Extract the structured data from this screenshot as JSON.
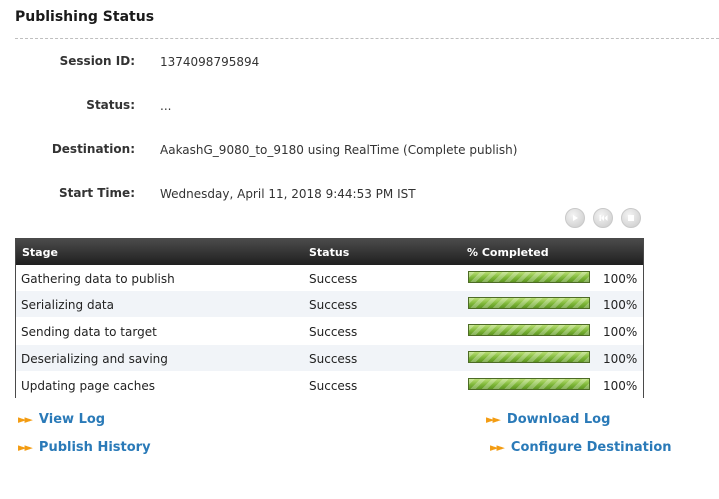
{
  "header": {
    "title": "Publishing Status"
  },
  "fields": {
    "session_id": {
      "label": "Session ID:",
      "value": "1374098795894"
    },
    "status": {
      "label": "Status:",
      "value": "..."
    },
    "destination": {
      "label": "Destination:",
      "value": "AakashG_9080_to_9180 using RealTime (Complete publish)"
    },
    "start_time": {
      "label": "Start Time:",
      "value": "Wednesday, April 11, 2018 9:44:53 PM IST"
    }
  },
  "controls": [
    "play-icon",
    "rewind-icon",
    "stop-icon"
  ],
  "table": {
    "columns": [
      "Stage",
      "Status",
      "% Completed"
    ],
    "rows": [
      {
        "stage": "Gathering data to publish",
        "status": "Success",
        "progress": 100,
        "percent": "100%"
      },
      {
        "stage": "Serializing data",
        "status": "Success",
        "progress": 100,
        "percent": "100%"
      },
      {
        "stage": "Sending data to target",
        "status": "Success",
        "progress": 100,
        "percent": "100%"
      },
      {
        "stage": "Deserializing and saving",
        "status": "Success",
        "progress": 100,
        "percent": "100%"
      },
      {
        "stage": "Updating page caches",
        "status": "Success",
        "progress": 100,
        "percent": "100%"
      }
    ]
  },
  "links": {
    "view_log": "View Log",
    "download_log": "Download Log",
    "publish_history": "Publish History",
    "configure_destination": "Configure Destination"
  },
  "colors": {
    "link": "#2a7ab8",
    "link_arrow": "#f39c12",
    "progress_fill": "#7fb83a",
    "header_bg": "#2f2f2f"
  }
}
